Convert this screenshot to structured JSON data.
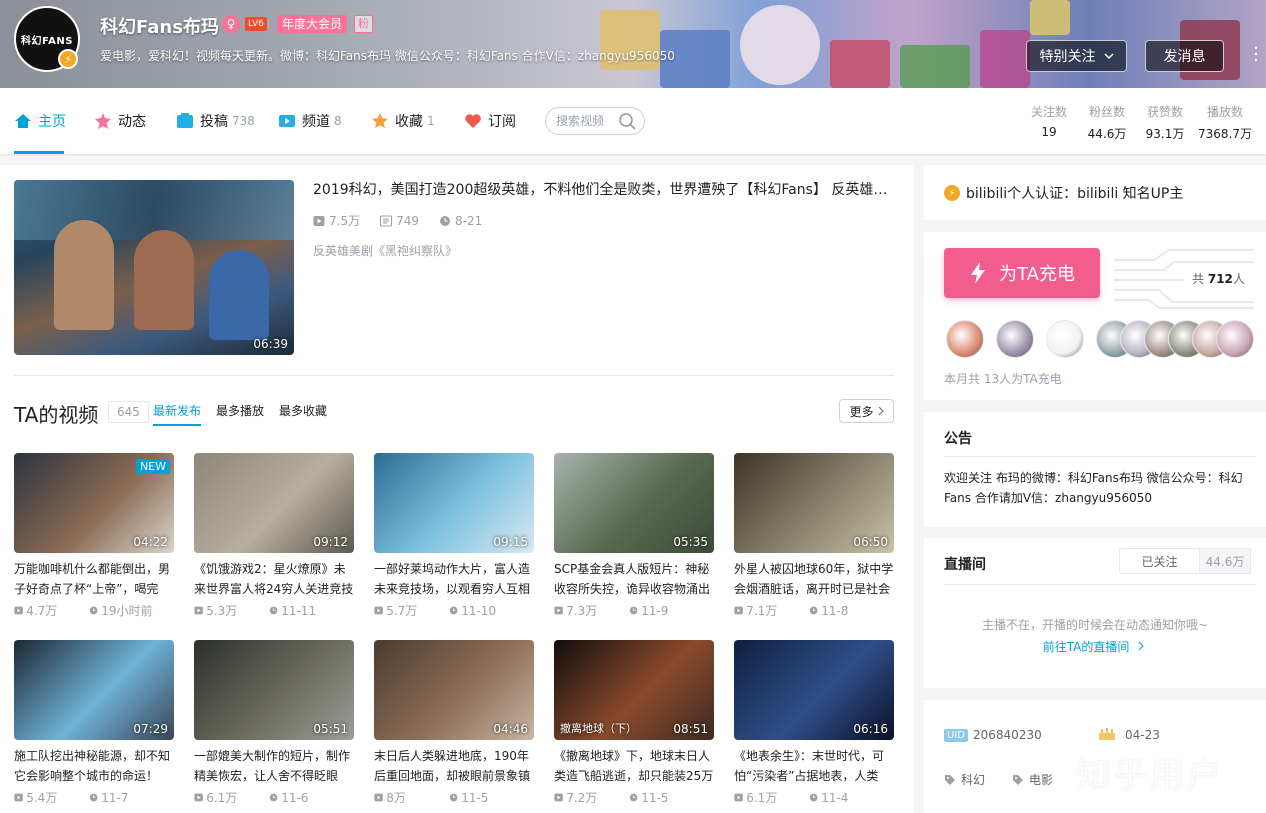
{
  "header": {
    "avatar_text": "科幻FANS",
    "username": "科幻Fans布玛",
    "gender_symbol": "♀",
    "level": "LV6",
    "vip": "年度大会员",
    "fan_tag": "粉",
    "sign": "爱电影，爱科幻！视频每天更新。微博：科幻Fans布玛 微信公众号：科幻Fans 合作V信：zhangyu956050",
    "follow_label": "特别关注",
    "message_label": "发消息"
  },
  "nav": {
    "home": "主页",
    "dynamic": "动态",
    "posts": "投稿",
    "posts_count": "738",
    "channels": "频道",
    "channels_count": "8",
    "favorites": "收藏",
    "favorites_count": "1",
    "subscriptions": "订阅",
    "search_placeholder": "搜索视频"
  },
  "stats": [
    {
      "label": "关注数",
      "value": "19"
    },
    {
      "label": "粉丝数",
      "value": "44.6万"
    },
    {
      "label": "获赞数",
      "value": "93.1万"
    },
    {
      "label": "播放数",
      "value": "7368.7万"
    }
  ],
  "featured": {
    "title": "2019科幻，美国打造200超级英雄，不料他们全是败类，世界遭殃了【科幻Fans】 反英雄美...",
    "plays": "7.5万",
    "danmaku": "749",
    "date": "8-21",
    "tag": "反英雄美剧《黑袍纠察队》",
    "duration": "06:39"
  },
  "videos_section": {
    "title": "TA的视频",
    "count": "645",
    "sort_new": "最新发布",
    "sort_play": "最多播放",
    "sort_fav": "最多收藏",
    "more": "更多"
  },
  "videos": [
    {
      "title": "万能咖啡机什么都能倒出，男子好奇点了杯“上帝”，喝完",
      "plays": "4.7万",
      "time": "19小时前",
      "duration": "04:22",
      "badge": "NEW",
      "caption": "",
      "colors": [
        "#2c3440",
        "#8a6a52",
        "#d9d4cc"
      ]
    },
    {
      "title": "《饥饿游戏2：星火燎原》未来世界富人将24穷人关进竞技",
      "plays": "5.3万",
      "time": "11-11",
      "duration": "09:12",
      "badge": "",
      "caption": "",
      "colors": [
        "#8d8778",
        "#b7ae9d",
        "#5e5a50"
      ]
    },
    {
      "title": "一部好莱坞动作大片，富人造未来竞技场，以观看穷人互相",
      "plays": "5.7万",
      "time": "11-10",
      "duration": "09:15",
      "badge": "",
      "caption": "",
      "colors": [
        "#2a6c94",
        "#7fc3e2",
        "#d8e8ee"
      ]
    },
    {
      "title": "SCP基金会真人版短片：神秘收容所失控，诡异收容物涌出",
      "plays": "7.3万",
      "time": "11-9",
      "duration": "05:35",
      "badge": "",
      "caption": "",
      "colors": [
        "#a9b2ad",
        "#566b4f",
        "#3c4a38"
      ]
    },
    {
      "title": "外星人被囚地球60年，狱中学会烟酒脏话，离开时已是社会",
      "plays": "7.1万",
      "time": "11-8",
      "duration": "06:50",
      "badge": "",
      "caption": "",
      "colors": [
        "#3d3326",
        "#8a826c",
        "#c9c2a8"
      ]
    },
    {
      "title": "施工队挖出神秘能源，却不知它会影响整个城市的命运！",
      "plays": "5.4万",
      "time": "11-7",
      "duration": "07:29",
      "badge": "",
      "caption": "",
      "colors": [
        "#1d2733",
        "#6fb2d8",
        "#3a4654"
      ]
    },
    {
      "title": "一部媲美大制作的短片，制作精美恢宏，让人舍不得眨眼",
      "plays": "6.1万",
      "time": "11-6",
      "duration": "05:51",
      "badge": "",
      "caption": "",
      "colors": [
        "#2c2f2c",
        "#6b6b5e",
        "#9c9f98"
      ]
    },
    {
      "title": "末日后人类躲进地底，190年后重回地面，却被眼前景象镇",
      "plays": "8万",
      "time": "11-5",
      "duration": "04:46",
      "badge": "",
      "caption": "",
      "colors": [
        "#4b3b2e",
        "#8d6e58",
        "#c8b6a4"
      ]
    },
    {
      "title": "《撤离地球》下，地球末日人类造飞船逃逝，却只能装25万",
      "plays": "7.2万",
      "time": "11-5",
      "duration": "08:51",
      "badge": "",
      "caption": "撤离地球（下）",
      "colors": [
        "#120d0c",
        "#8a4a2c",
        "#3c2a22"
      ]
    },
    {
      "title": "《地表余生》：末世时代，可怕“污染者”占据地表，人类",
      "plays": "6.1万",
      "time": "11-4",
      "duration": "06:16",
      "badge": "",
      "caption": "",
      "colors": [
        "#0f1f3e",
        "#2f4f8a",
        "#0a1126"
      ]
    }
  ],
  "verification": "bilibili个人认证：bilibili 知名UP主",
  "charge": {
    "button": "为TA充电",
    "total_prefix": "共",
    "total": "712",
    "total_suffix": "人",
    "note": "本月共 13人为TA充电",
    "supporter_colors": [
      "#d9896e",
      "#9a8fa6",
      "#f2f2f2",
      "#8fa4a8",
      "#b8b3c4",
      "#a08e84",
      "#8c8c7c",
      "#c6a79b",
      "#c9a2b4"
    ]
  },
  "notice": {
    "title": "公告",
    "text": "欢迎关注 布玛的微博：科幻Fans布玛 微信公众号：科幻Fans 合作请加V信：zhangyu956050"
  },
  "live": {
    "title": "直播间",
    "followed": "已关注",
    "count": "44.6万",
    "empty": "主播不在，开播的时候会在动态通知你哦~",
    "link": "前往TA的直播间"
  },
  "info": {
    "uid_label": "UID",
    "uid": "206840230",
    "birthday": "04-23",
    "tags": [
      "科幻",
      "电影"
    ]
  },
  "watermark": "知乎用户",
  "colors": {
    "accent": "#00a1d6",
    "pink": "#fb7299",
    "charge": "#f25d8e"
  }
}
